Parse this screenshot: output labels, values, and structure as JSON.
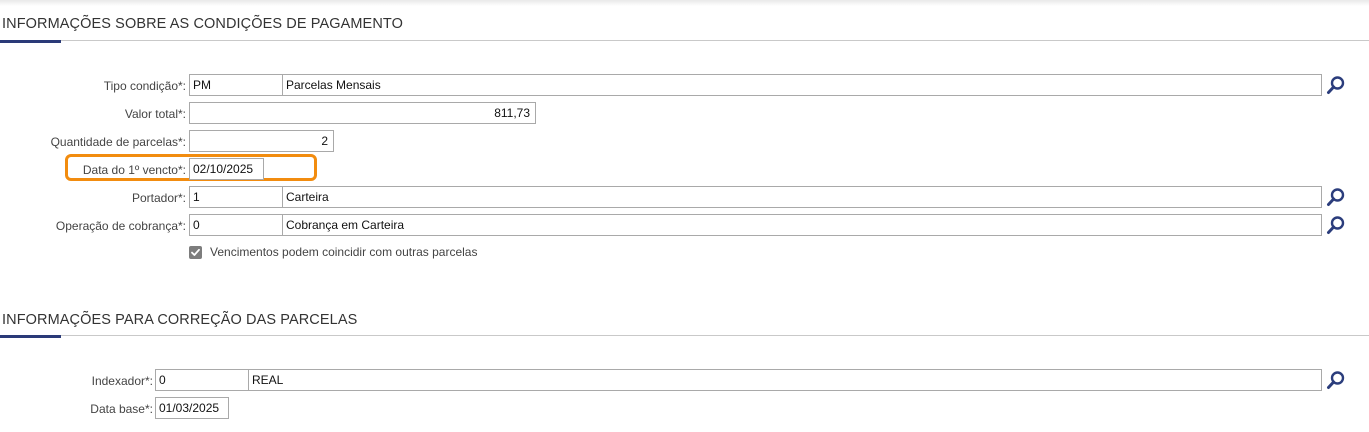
{
  "payment_section": {
    "title": "INFORMAÇÕES SOBRE AS CONDIÇÕES DE PAGAMENTO",
    "tipo_condicao": {
      "label": "Tipo condição*:",
      "code": "PM",
      "description": "Parcelas Mensais"
    },
    "valor_total": {
      "label": "Valor total*:",
      "value": "811,73"
    },
    "quantidade_parcelas": {
      "label": "Quantidade de parcelas*:",
      "value": "2"
    },
    "data_vencto": {
      "label": "Data do 1º vencto*:",
      "value": "02/10/2025"
    },
    "portador": {
      "label": "Portador*:",
      "code": "1",
      "description": "Carteira"
    },
    "operacao_cobranca": {
      "label": "Operação de cobrança*:",
      "code": "0",
      "description": "Cobrança em Carteira"
    },
    "vencimentos_checkbox": {
      "label": "Vencimentos podem coincidir com outras parcelas",
      "checked": true
    }
  },
  "correction_section": {
    "title": "INFORMAÇÕES PARA CORREÇÃO DAS PARCELAS",
    "indexador": {
      "label": "Indexador*:",
      "code": "0",
      "description": "REAL"
    },
    "data_base": {
      "label": "Data base*:",
      "value": "01/03/2025"
    }
  },
  "icons": {
    "lookup": "magnifier-icon",
    "checkbox": "checkmark-icon"
  },
  "colors": {
    "highlight": "#f28c0f",
    "accent_bar": "#2a3a78",
    "lookup_icon": "#2b3d7c"
  }
}
